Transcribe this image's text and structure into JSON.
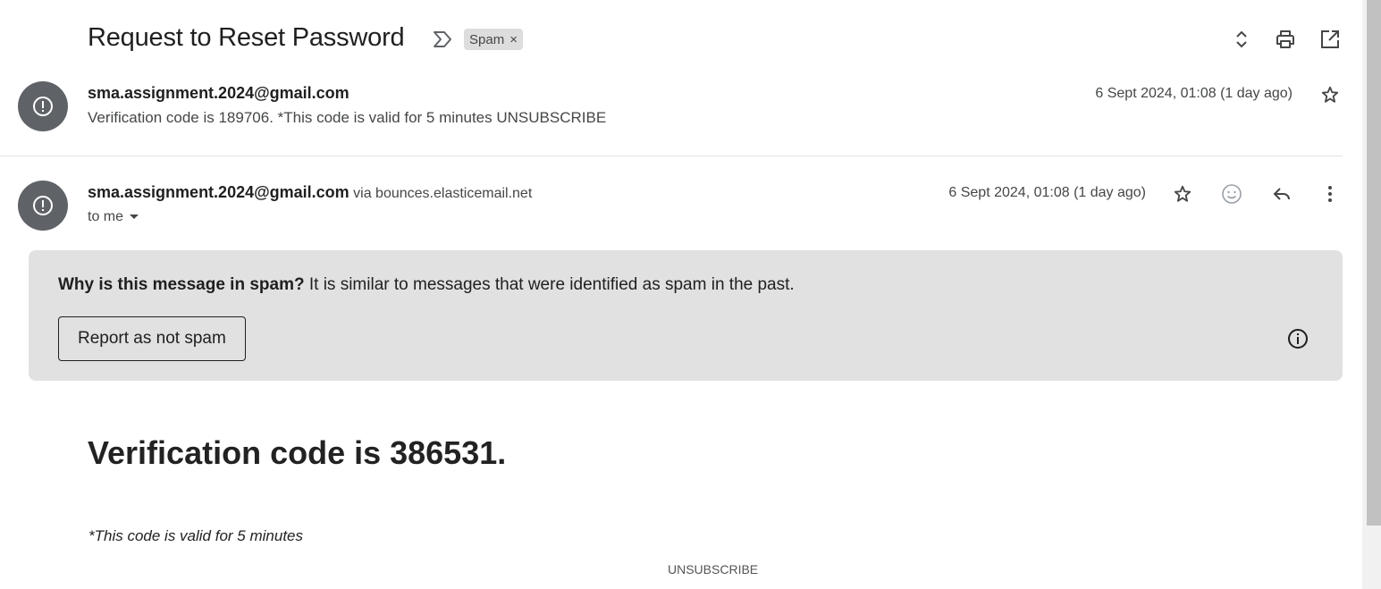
{
  "thread": {
    "subject": "Request to Reset Password",
    "label": "Spam",
    "label_remove": "×",
    "icons": {
      "important": "importance-marker-icon",
      "expand": "expand-collapse-icon",
      "print": "print-icon",
      "popout": "open-in-new-window-icon"
    }
  },
  "messages": [
    {
      "sender": "sma.assignment.2024@gmail.com",
      "snippet": "Verification code is 189706. *This code is valid for 5 minutes UNSUBSCRIBE",
      "date": "6 Sept 2024, 01:08 (1 day ago)",
      "avatar_icon": "exclamation-icon",
      "star_icon": "star-outline-icon"
    },
    {
      "sender": "sma.assignment.2024@gmail.com",
      "via_label": "via",
      "via_domain": "bounces.elasticemail.net",
      "recipient": "to me",
      "date": "6 Sept 2024, 01:08 (1 day ago)",
      "avatar_icon": "exclamation-icon",
      "actions": [
        "star-outline-icon",
        "emoji-reaction-icon",
        "reply-icon",
        "more-vert-icon"
      ]
    }
  ],
  "spam_warning": {
    "question": "Why is this message in spam?",
    "explanation": " It is similar to messages that were identified as spam in the past.",
    "button_label": "Report as not spam",
    "info_icon": "info-icon"
  },
  "email_body": {
    "heading": "Verification code is 386531.",
    "validity": "*This code is valid for 5 minutes",
    "unsubscribe": "UNSUBSCRIBE"
  },
  "colors": {
    "avatar_bg": "#5f6368",
    "spam_box_bg": "#e1e1e1",
    "label_bg": "#dddddd",
    "text_primary": "#1f1f1f",
    "text_secondary": "#444746"
  }
}
